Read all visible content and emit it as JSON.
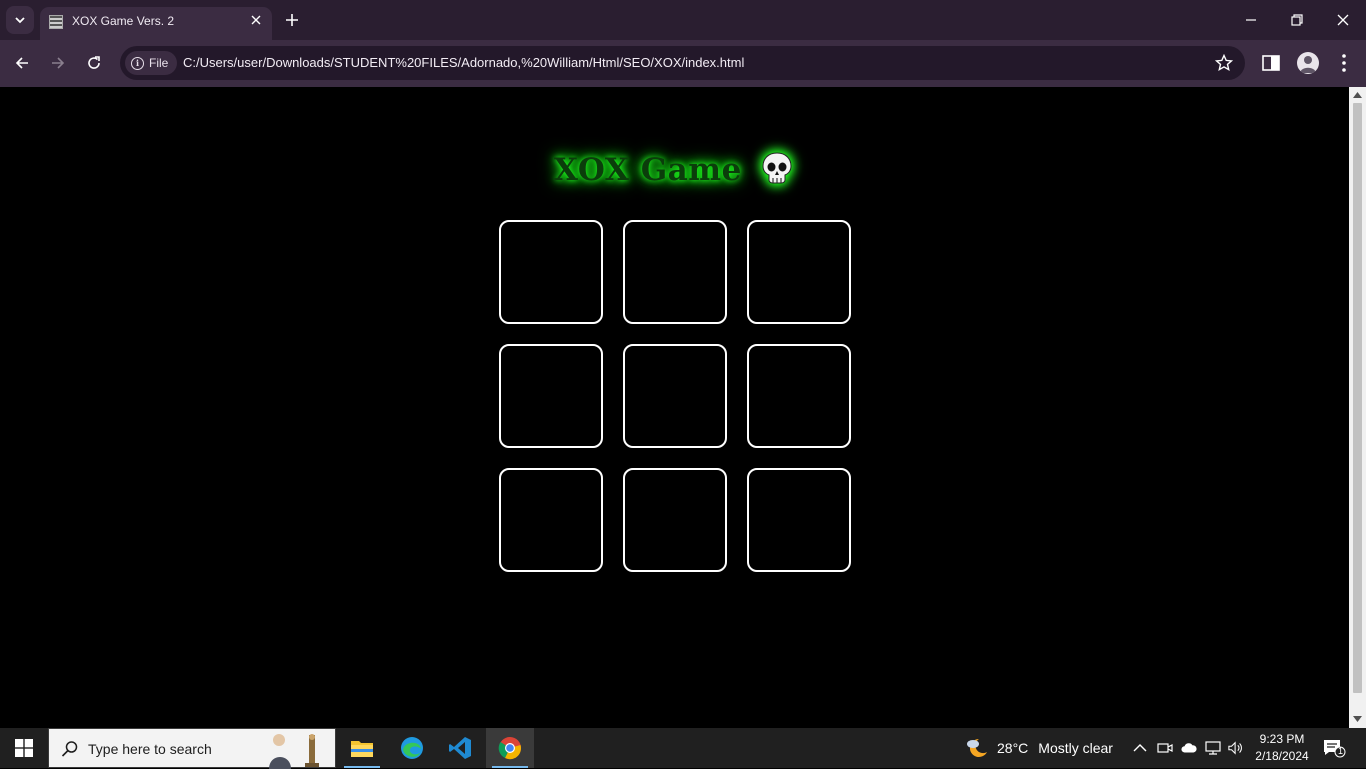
{
  "browser": {
    "tab_title": "XOX Game Vers. 2",
    "chip_label": "File",
    "url": "C:/Users/user/Downloads/STUDENT%20FILES/Adornado,%20William/Html/SEO/XOX/index.html"
  },
  "page": {
    "heading": "XOX Game",
    "heading_emoji_icon": "skull-icon",
    "board_cells": [
      "",
      "",
      "",
      "",
      "",
      "",
      "",
      "",
      ""
    ]
  },
  "taskbar": {
    "search_placeholder": "Type here to search",
    "apps": [
      "file-explorer-icon",
      "edge-icon",
      "vscode-icon",
      "chrome-icon"
    ],
    "weather_temp": "28°C",
    "weather_condition": "Mostly clear",
    "time": "9:23 PM",
    "date": "2/18/2024",
    "notification_count": "1"
  },
  "colors": {
    "heading_glow": "#1fff1f",
    "heading_text": "#0b3d0b",
    "cell_border": "#ffffff",
    "page_bg": "#000000"
  }
}
